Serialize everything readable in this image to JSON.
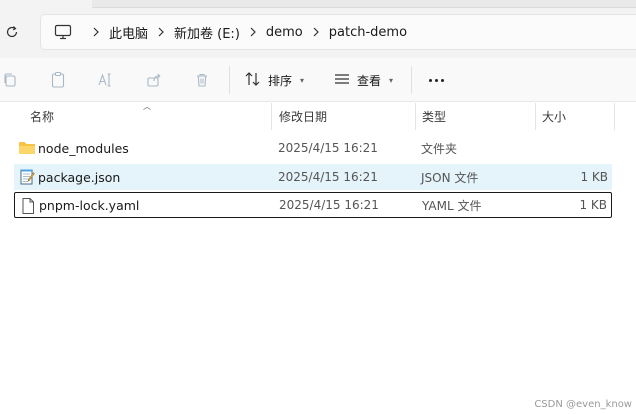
{
  "breadcrumb": {
    "items": [
      "此电脑",
      "新加卷 (E:)",
      "demo",
      "patch-demo"
    ]
  },
  "toolbar": {
    "sort_label": "排序",
    "view_label": "查看"
  },
  "columns": {
    "name": "名称",
    "date": "修改日期",
    "type": "类型",
    "size": "大小"
  },
  "files": [
    {
      "name": "node_modules",
      "date": "2025/4/15 16:21",
      "type": "文件夹",
      "size": "",
      "icon": "folder-icon"
    },
    {
      "name": "package.json",
      "date": "2025/4/15 16:21",
      "type": "JSON 文件",
      "size": "1 KB",
      "icon": "notepad-file-icon"
    },
    {
      "name": "pnpm-lock.yaml",
      "date": "2025/4/15 16:21",
      "type": "YAML 文件",
      "size": "1 KB",
      "icon": "blank-file-icon"
    }
  ],
  "watermark": "CSDN @even_know",
  "colors": {
    "hover_row": "#e5f3fb",
    "folder": "#f8c245",
    "selection_border": "#1a1a1a"
  }
}
